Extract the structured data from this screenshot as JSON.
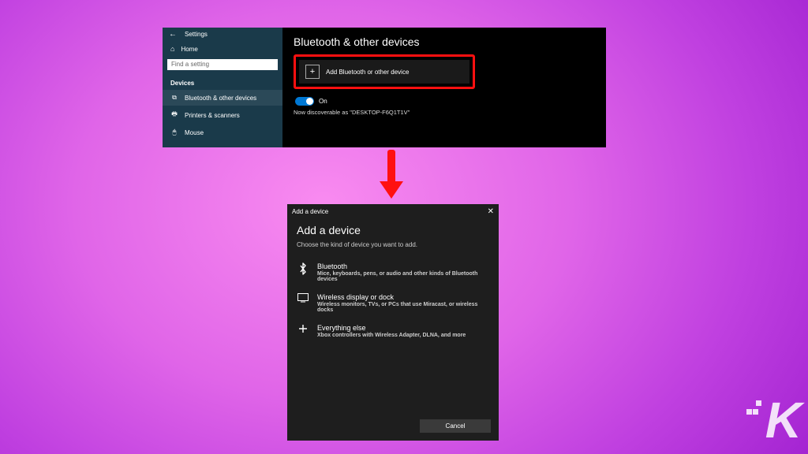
{
  "settings": {
    "window_title": "Settings",
    "home_label": "Home",
    "search_placeholder": "Find a setting",
    "section_label": "Devices",
    "sidebar_items": [
      {
        "icon": "⧉",
        "label": "Bluetooth & other devices"
      },
      {
        "icon": "🖶",
        "label": "Printers & scanners"
      },
      {
        "icon": "🖱",
        "label": "Mouse"
      }
    ],
    "page_heading": "Bluetooth & other devices",
    "add_button_label": "Add Bluetooth or other device",
    "toggle": {
      "state": "On"
    },
    "discoverable_text": "Now discoverable as \"DESKTOP-F6Q1T1V\""
  },
  "dialog": {
    "titlebar": "Add a device",
    "heading": "Add a device",
    "subheading": "Choose the kind of device you want to add.",
    "options": [
      {
        "icon": "bluetooth",
        "title": "Bluetooth",
        "desc": "Mice, keyboards, pens, or audio and other kinds of Bluetooth devices"
      },
      {
        "icon": "display",
        "title": "Wireless display or dock",
        "desc": "Wireless monitors, TVs, or PCs that use Miracast, or wireless docks"
      },
      {
        "icon": "plus",
        "title": "Everything else",
        "desc": "Xbox controllers with Wireless Adapter, DLNA, and more"
      }
    ],
    "cancel_label": "Cancel"
  },
  "colors": {
    "highlight": "#ff1010",
    "accent": "#0078d4",
    "sidebar_bg": "#1a3a4a",
    "dialog_bg": "#1e1e1e"
  },
  "logo_letter": "K"
}
